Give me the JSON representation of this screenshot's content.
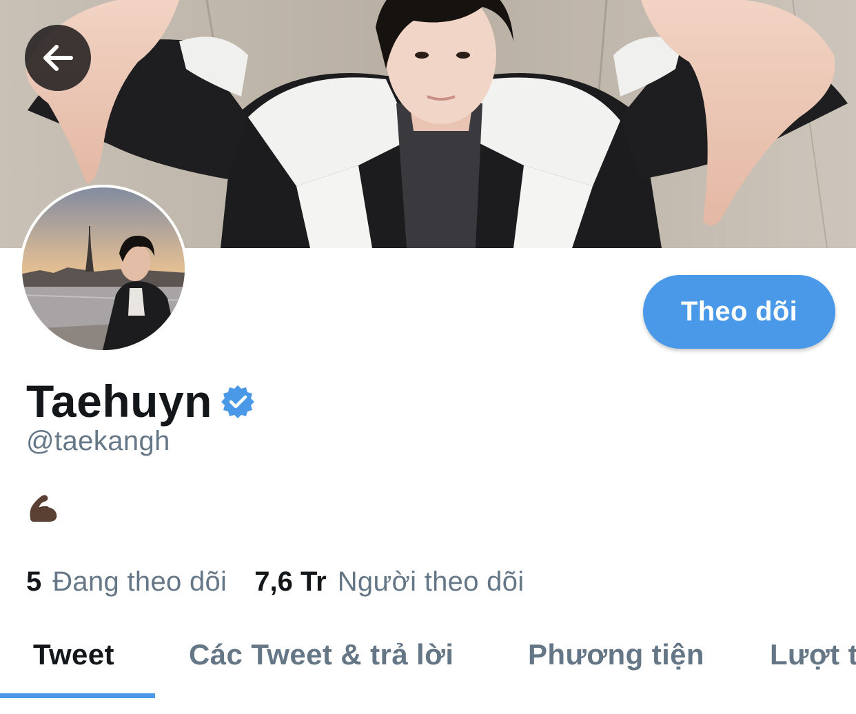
{
  "theme": {
    "accent": "#4a99e9",
    "text_primary": "#14171a",
    "text_secondary": "#657786"
  },
  "header": {
    "back_icon": "arrow-left-icon",
    "banner_image": "profile-banner-photo"
  },
  "profile": {
    "avatar_image": "profile-avatar-photo",
    "display_name": "Taehuyn",
    "verified_icon": "verified-badge-icon",
    "handle": "@taekangh",
    "bio_emoji_icon": "flexed-biceps-emoji-icon",
    "follow_label": "Theo dõi"
  },
  "stats": {
    "following_count": "5",
    "following_label": "Đang theo dõi",
    "followers_count": "7,6 Tr",
    "followers_label": "Người theo dõi"
  },
  "tabs": [
    {
      "label": "Tweet",
      "active": true
    },
    {
      "label": "Các Tweet & trả lời",
      "active": false
    },
    {
      "label": "Phương tiện",
      "active": false
    },
    {
      "label": "Lượt thích",
      "active": false
    }
  ]
}
